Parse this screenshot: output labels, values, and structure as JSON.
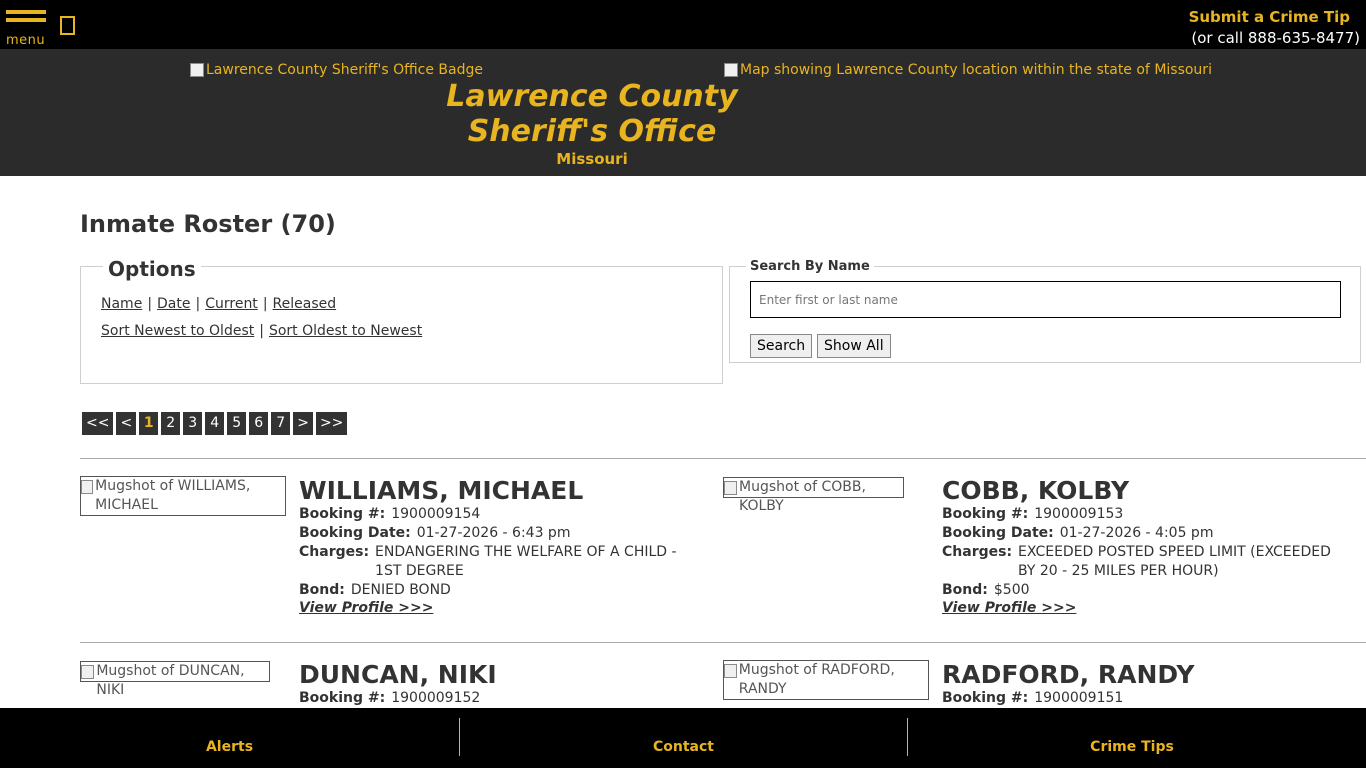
{
  "topbar": {
    "menu_label": "menu",
    "tip_link": "Submit a Crime Tip",
    "tip_phone": "(or call 888-635-8477)"
  },
  "header": {
    "badge_alt": "Lawrence County Sheriff's Office Badge",
    "map_alt": "Map showing Lawrence County location within the state of Missouri",
    "title_line1": "Lawrence County",
    "title_line2": "Sheriff's Office",
    "state": "Missouri"
  },
  "page": {
    "title": "Inmate Roster (70)"
  },
  "options": {
    "legend": "Options",
    "filters": [
      "Name",
      "Date",
      "Current",
      "Released"
    ],
    "sorts": [
      "Sort Newest to Oldest",
      "Sort Oldest to Newest"
    ],
    "separator": "|"
  },
  "search": {
    "legend": "Search By Name",
    "placeholder": "Enter first or last name",
    "value": "",
    "search_button": "Search",
    "show_all_button": "Show All"
  },
  "pagination": {
    "first": "<<",
    "prev": "<",
    "pages": [
      "1",
      "2",
      "3",
      "4",
      "5",
      "6",
      "7"
    ],
    "current": "1",
    "next": ">",
    "last": ">>"
  },
  "labels": {
    "booking_no": "Booking #:",
    "booking_date": "Booking Date:",
    "charges": "Charges:",
    "bond": "Bond:",
    "view_profile": "View Profile >>>"
  },
  "inmates": [
    {
      "mug_alt": "Mugshot of WILLIAMS, MICHAEL",
      "name": "WILLIAMS, MICHAEL",
      "booking_no": "1900009154",
      "booking_date": "01-27-2026 - 6:43 pm",
      "charges": "ENDANGERING THE WELFARE OF A CHILD - 1ST DEGREE",
      "bond": "DENIED BOND"
    },
    {
      "mug_alt": "Mugshot of COBB, KOLBY",
      "name": "COBB, KOLBY",
      "booking_no": "1900009153",
      "booking_date": "01-27-2026 - 4:05 pm",
      "charges": "EXCEEDED POSTED SPEED LIMIT (EXCEEDED BY 20 - 25 MILES PER HOUR)",
      "bond": "$500"
    },
    {
      "mug_alt": "Mugshot of DUNCAN, NIKI",
      "name": "DUNCAN, NIKI",
      "booking_no": "1900009152"
    },
    {
      "mug_alt": "Mugshot of RADFORD, RANDY",
      "name": "RADFORD, RANDY",
      "booking_no": "1900009151"
    }
  ],
  "footer": {
    "items": [
      "Alerts",
      "Contact",
      "Crime Tips"
    ]
  },
  "colors": {
    "accent": "#e8b420",
    "topbar": "#000000",
    "header": "#2b2b2b"
  }
}
